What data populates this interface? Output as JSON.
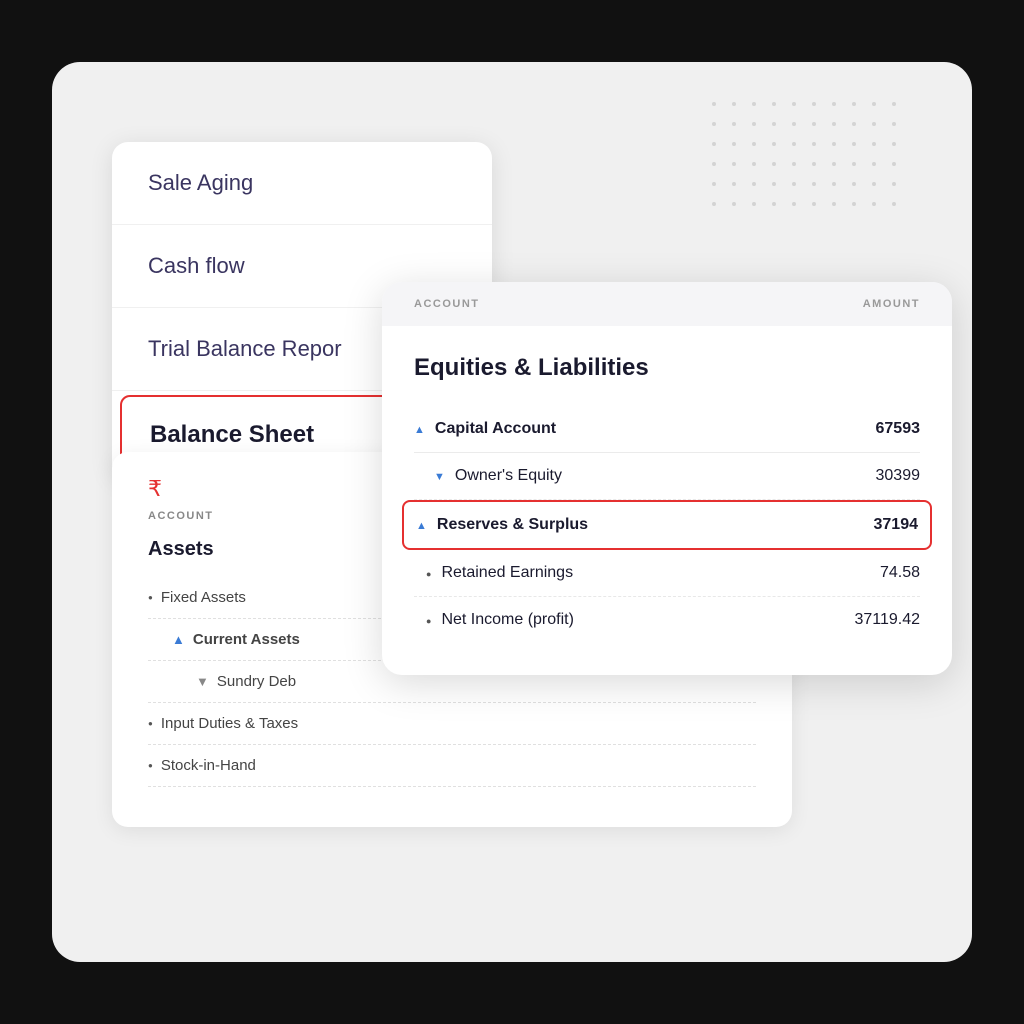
{
  "outer": {
    "background": "#f0f0f0"
  },
  "menu": {
    "items": [
      {
        "id": "sale-aging",
        "label": "Sale Aging",
        "active": false
      },
      {
        "id": "cash-flow",
        "label": "Cash flow",
        "active": false
      },
      {
        "id": "trial-balance",
        "label": "Trial Balance Repor",
        "active": false
      },
      {
        "id": "balance-sheet",
        "label": "Balance Sheet",
        "active": true
      }
    ]
  },
  "background_sheet": {
    "account_header": "ACCOUNT",
    "rupee_symbol": "₹",
    "assets_title": "Assets",
    "rows": [
      {
        "id": "fixed-assets",
        "label": "Fixed Assets",
        "type": "bullet",
        "indent": 1
      },
      {
        "id": "current-assets",
        "label": "Current Assets",
        "type": "chevron-up",
        "indent": 1,
        "bold": true
      },
      {
        "id": "sundry-deb",
        "label": "Sundry Deb",
        "type": "chevron-down",
        "indent": 2
      },
      {
        "id": "input-duties",
        "label": "Input Duties & Taxes",
        "type": "bullet",
        "indent": 1
      },
      {
        "id": "stock-in-hand",
        "label": "Stock-in-Hand",
        "type": "bullet",
        "indent": 1
      }
    ]
  },
  "front_panel": {
    "header": {
      "account_label": "ACCOUNT",
      "amount_label": "AMOUNT"
    },
    "title": "Equities & Liabilities",
    "rows": [
      {
        "id": "capital-account",
        "label": "Capital Account",
        "value": "67593",
        "type": "chevron-up",
        "bold": true,
        "indent": 0,
        "highlighted": false
      },
      {
        "id": "owners-equity",
        "label": "Owner's Equity",
        "value": "30399",
        "type": "chevron-down",
        "bold": false,
        "indent": 1,
        "highlighted": false
      },
      {
        "id": "reserves-surplus",
        "label": "Reserves & Surplus",
        "value": "37194",
        "type": "chevron-up",
        "bold": true,
        "indent": 0,
        "highlighted": true
      },
      {
        "id": "retained-earnings",
        "label": "Retained Earnings",
        "value": "74.58",
        "type": "bullet",
        "bold": false,
        "indent": 1,
        "highlighted": false
      },
      {
        "id": "net-income",
        "label": "Net Income (profit)",
        "value": "37119.42",
        "type": "bullet",
        "bold": false,
        "indent": 1,
        "highlighted": false
      }
    ]
  }
}
